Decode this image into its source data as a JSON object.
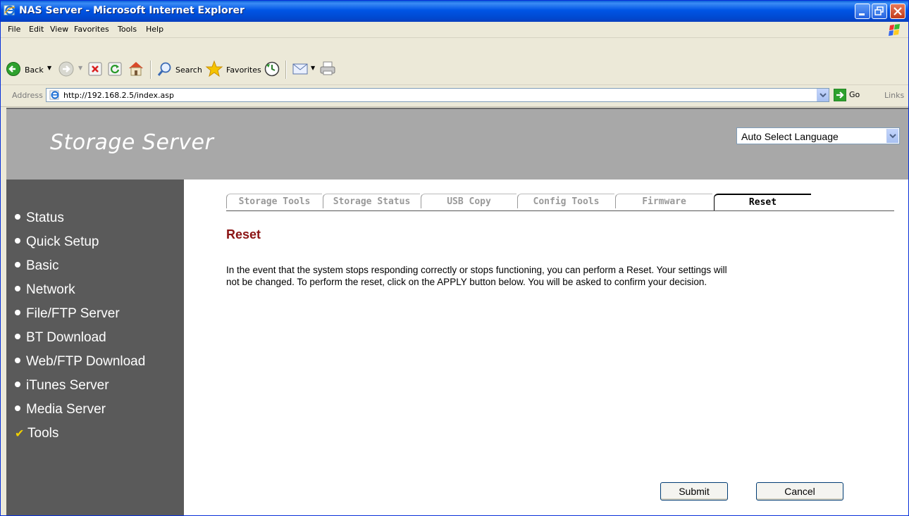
{
  "window": {
    "title": "NAS Server - Microsoft Internet Explorer"
  },
  "menubar": {
    "items": [
      "File",
      "Edit",
      "View",
      "Favorites",
      "Tools",
      "Help"
    ]
  },
  "toolbar": {
    "back_label": "Back",
    "search_label": "Search",
    "favorites_label": "Favorites"
  },
  "address": {
    "label": "Address",
    "url": "http://192.168.2.5/index.asp",
    "go_label": "Go",
    "links_label": "Links"
  },
  "header": {
    "brand": "Storage Server",
    "language_selected": "Auto Select Language"
  },
  "sidebar": {
    "items": [
      {
        "label": "Status",
        "current": false
      },
      {
        "label": "Quick Setup",
        "current": false
      },
      {
        "label": "Basic",
        "current": false
      },
      {
        "label": "Network",
        "current": false
      },
      {
        "label": "File/FTP Server",
        "current": false
      },
      {
        "label": "BT Download",
        "current": false
      },
      {
        "label": "Web/FTP Download",
        "current": false
      },
      {
        "label": "iTunes Server",
        "current": false
      },
      {
        "label": "Media Server",
        "current": false
      },
      {
        "label": "Tools",
        "current": true
      }
    ]
  },
  "tabs": [
    {
      "label": "Storage Tools",
      "active": false
    },
    {
      "label": "Storage Status",
      "active": false
    },
    {
      "label": "USB Copy",
      "active": false
    },
    {
      "label": "Config Tools",
      "active": false
    },
    {
      "label": "Firmware",
      "active": false
    },
    {
      "label": "Reset",
      "active": true
    }
  ],
  "main": {
    "title": "Reset",
    "description_line1": "In the event that the system stops responding correctly or stops functioning, you can perform a Reset. Your settings will",
    "description_line2": "not be changed. To perform the reset, click on the APPLY button below. You will be asked to confirm your decision.",
    "submit_label": "Submit",
    "cancel_label": "Cancel"
  },
  "colors": {
    "titlebar": "#0055e5",
    "header_band": "#a8a8a8",
    "sidebar": "#5a5a5a",
    "section_title": "#8b1414",
    "check_mark": "#f0d000"
  }
}
